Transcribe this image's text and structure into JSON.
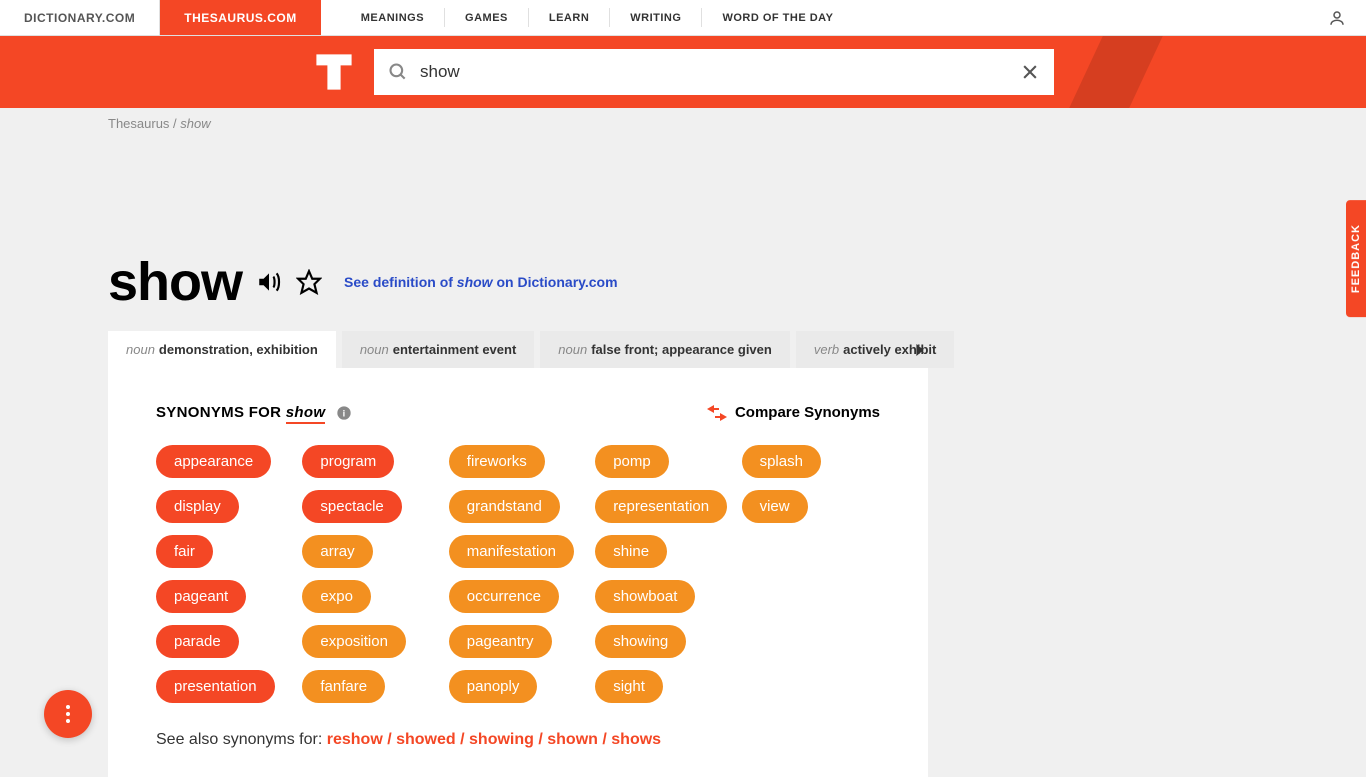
{
  "nav": {
    "site1": "DICTIONARY.COM",
    "site2": "THESAURUS.COM",
    "links": [
      "MEANINGS",
      "GAMES",
      "LEARN",
      "WRITING",
      "WORD OF THE DAY"
    ]
  },
  "search": {
    "value": "show"
  },
  "breadcrumb": {
    "root": "Thesaurus",
    "sep": " / ",
    "word": "show"
  },
  "headword": "show",
  "defLink": {
    "pre": "See definition of ",
    "word": "show",
    "post": " on Dictionary.com"
  },
  "tabs": [
    {
      "pos": "noun",
      "def": "demonstration, exhibition"
    },
    {
      "pos": "noun",
      "def": "entertainment event"
    },
    {
      "pos": "noun",
      "def": "false front; appearance given"
    },
    {
      "pos": "verb",
      "def": "actively exhibit"
    }
  ],
  "synHeader": {
    "label": "SYNONYMS FOR ",
    "word": "show"
  },
  "compare": "Compare Synonyms",
  "synonyms": [
    {
      "w": "appearance",
      "s": "strong"
    },
    {
      "w": "display",
      "s": "strong"
    },
    {
      "w": "fair",
      "s": "strong"
    },
    {
      "w": "pageant",
      "s": "strong"
    },
    {
      "w": "parade",
      "s": "strong"
    },
    {
      "w": "presentation",
      "s": "strong"
    },
    {
      "w": "program",
      "s": "strong"
    },
    {
      "w": "spectacle",
      "s": "strong"
    },
    {
      "w": "array",
      "s": "medium"
    },
    {
      "w": "expo",
      "s": "medium"
    },
    {
      "w": "exposition",
      "s": "medium"
    },
    {
      "w": "fanfare",
      "s": "medium"
    },
    {
      "w": "fireworks",
      "s": "medium"
    },
    {
      "w": "grandstand",
      "s": "medium"
    },
    {
      "w": "manifestation",
      "s": "medium"
    },
    {
      "w": "occurrence",
      "s": "medium"
    },
    {
      "w": "pageantry",
      "s": "medium"
    },
    {
      "w": "panoply",
      "s": "medium"
    },
    {
      "w": "pomp",
      "s": "medium"
    },
    {
      "w": "representation",
      "s": "medium"
    },
    {
      "w": "shine",
      "s": "medium"
    },
    {
      "w": "showboat",
      "s": "medium"
    },
    {
      "w": "showing",
      "s": "medium"
    },
    {
      "w": "sight",
      "s": "medium"
    },
    {
      "w": "splash",
      "s": "medium"
    },
    {
      "w": "view",
      "s": "medium"
    }
  ],
  "seeAlso": {
    "label": "See also synonyms for: ",
    "links": [
      "reshow",
      "showed",
      "showing",
      "shown",
      "shows"
    ]
  },
  "feedback": "FEEDBACK"
}
